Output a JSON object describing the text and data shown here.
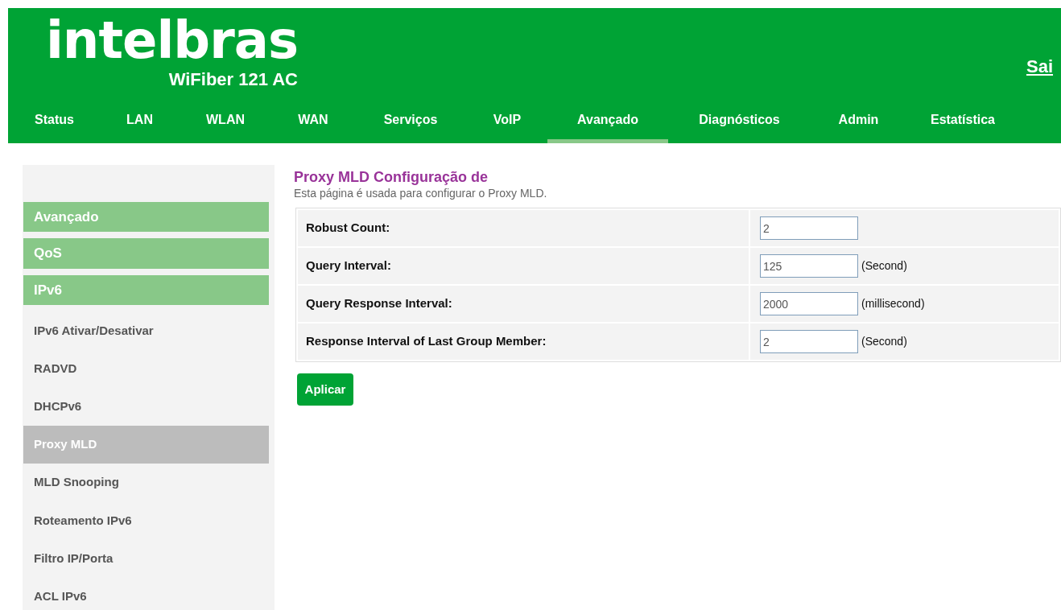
{
  "header": {
    "logo": "intelbras",
    "model": "WiFiber 121 AC",
    "logout": "Sai"
  },
  "nav": [
    {
      "label": "Status",
      "selected": false
    },
    {
      "label": "LAN",
      "selected": false
    },
    {
      "label": "WLAN",
      "selected": false
    },
    {
      "label": "WAN",
      "selected": false
    },
    {
      "label": "Serviços",
      "selected": false
    },
    {
      "label": "VoIP",
      "selected": false
    },
    {
      "label": "Avançado",
      "selected": true
    },
    {
      "label": "Diagnósticos",
      "selected": false
    },
    {
      "label": "Admin",
      "selected": false
    },
    {
      "label": "Estatística",
      "selected": false
    }
  ],
  "sidebar": {
    "items": [
      {
        "kind": "group",
        "label": "Avançado"
      },
      {
        "kind": "group",
        "label": "QoS"
      },
      {
        "kind": "group",
        "label": "IPv6"
      },
      {
        "kind": "item",
        "label": "IPv6 Ativar/Desativar",
        "selected": false
      },
      {
        "kind": "item",
        "label": "RADVD",
        "selected": false
      },
      {
        "kind": "item",
        "label": "DHCPv6",
        "selected": false
      },
      {
        "kind": "item",
        "label": "Proxy MLD",
        "selected": true
      },
      {
        "kind": "item",
        "label": "MLD Snooping",
        "selected": false
      },
      {
        "kind": "item",
        "label": "Roteamento IPv6",
        "selected": false
      },
      {
        "kind": "item",
        "label": "Filtro IP/Porta",
        "selected": false
      },
      {
        "kind": "item",
        "label": "ACL IPv6",
        "selected": false
      }
    ]
  },
  "page": {
    "title": "Proxy MLD Configuração de",
    "description": "Esta página é usada para configurar o Proxy MLD.",
    "fields": [
      {
        "label": "Robust Count:",
        "value": "2"
      },
      {
        "label": "Query Interval:",
        "value": "125",
        "unit": "(Second)"
      },
      {
        "label": "Query Response Interval:",
        "value": "2000",
        "unit": "(millisecond)"
      },
      {
        "label": "Response Interval of Last Group Member:",
        "value": "2",
        "unit": "(Second)"
      }
    ],
    "apply_button": "Aplicar"
  }
}
